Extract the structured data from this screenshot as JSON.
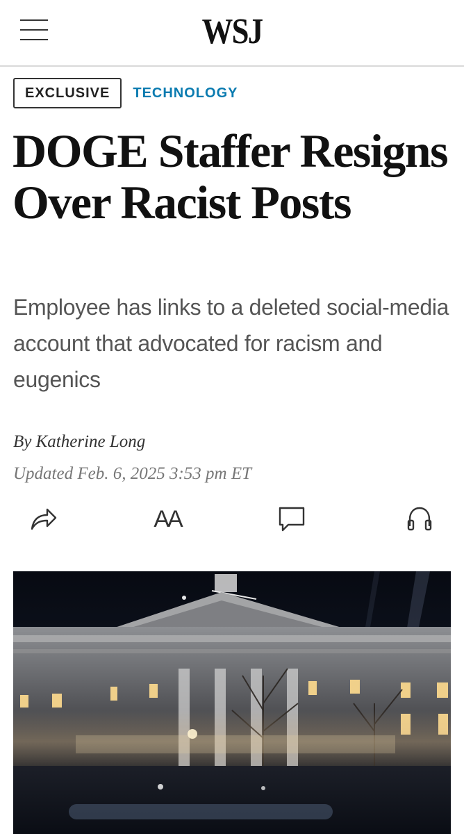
{
  "header": {
    "logo": "WSJ",
    "menu_icon": "hamburger-menu-icon"
  },
  "tags": {
    "flag": "EXCLUSIVE",
    "section": "TECHNOLOGY",
    "section_color": "#0a7bb0"
  },
  "article": {
    "headline": "DOGE Staffer Resigns Over Racist Posts",
    "dek": "Employee has links to a deleted social-media account that advocated for racism and eugenics",
    "byline_prefix": "By ",
    "author": "Katherine Long",
    "updated": "Updated Feb. 6, 2025 3:53 pm ET"
  },
  "toolbar": {
    "share_icon": "share-icon",
    "text_size_label": "AA",
    "comments_icon": "comment-icon",
    "listen_icon": "headphones-icon"
  },
  "image": {
    "description_icon": "hero-photo"
  }
}
